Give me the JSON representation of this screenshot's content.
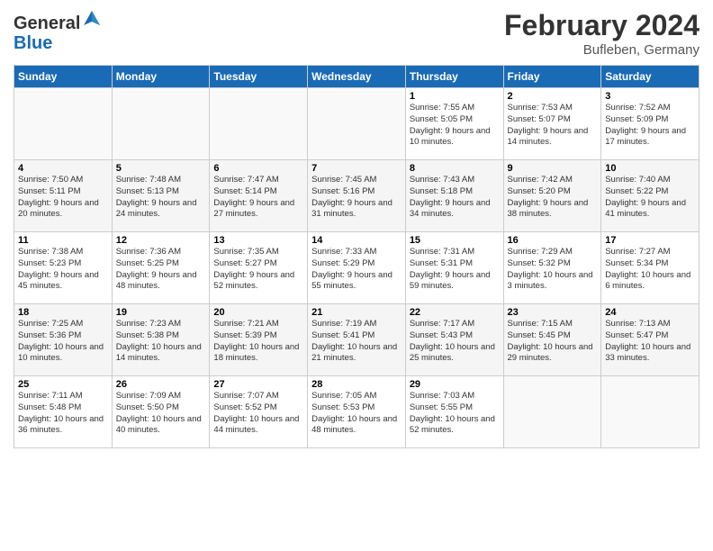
{
  "header": {
    "logo": {
      "general": "General",
      "blue": "Blue"
    },
    "title": "February 2024",
    "subtitle": "Bufleben, Germany"
  },
  "calendar": {
    "days_of_week": [
      "Sunday",
      "Monday",
      "Tuesday",
      "Wednesday",
      "Thursday",
      "Friday",
      "Saturday"
    ],
    "weeks": [
      {
        "alt": false,
        "days": [
          {
            "num": "",
            "info": ""
          },
          {
            "num": "",
            "info": ""
          },
          {
            "num": "",
            "info": ""
          },
          {
            "num": "",
            "info": ""
          },
          {
            "num": "1",
            "info": "Sunrise: 7:55 AM\nSunset: 5:05 PM\nDaylight: 9 hours\nand 10 minutes."
          },
          {
            "num": "2",
            "info": "Sunrise: 7:53 AM\nSunset: 5:07 PM\nDaylight: 9 hours\nand 14 minutes."
          },
          {
            "num": "3",
            "info": "Sunrise: 7:52 AM\nSunset: 5:09 PM\nDaylight: 9 hours\nand 17 minutes."
          }
        ]
      },
      {
        "alt": true,
        "days": [
          {
            "num": "4",
            "info": "Sunrise: 7:50 AM\nSunset: 5:11 PM\nDaylight: 9 hours\nand 20 minutes."
          },
          {
            "num": "5",
            "info": "Sunrise: 7:48 AM\nSunset: 5:13 PM\nDaylight: 9 hours\nand 24 minutes."
          },
          {
            "num": "6",
            "info": "Sunrise: 7:47 AM\nSunset: 5:14 PM\nDaylight: 9 hours\nand 27 minutes."
          },
          {
            "num": "7",
            "info": "Sunrise: 7:45 AM\nSunset: 5:16 PM\nDaylight: 9 hours\nand 31 minutes."
          },
          {
            "num": "8",
            "info": "Sunrise: 7:43 AM\nSunset: 5:18 PM\nDaylight: 9 hours\nand 34 minutes."
          },
          {
            "num": "9",
            "info": "Sunrise: 7:42 AM\nSunset: 5:20 PM\nDaylight: 9 hours\nand 38 minutes."
          },
          {
            "num": "10",
            "info": "Sunrise: 7:40 AM\nSunset: 5:22 PM\nDaylight: 9 hours\nand 41 minutes."
          }
        ]
      },
      {
        "alt": false,
        "days": [
          {
            "num": "11",
            "info": "Sunrise: 7:38 AM\nSunset: 5:23 PM\nDaylight: 9 hours\nand 45 minutes."
          },
          {
            "num": "12",
            "info": "Sunrise: 7:36 AM\nSunset: 5:25 PM\nDaylight: 9 hours\nand 48 minutes."
          },
          {
            "num": "13",
            "info": "Sunrise: 7:35 AM\nSunset: 5:27 PM\nDaylight: 9 hours\nand 52 minutes."
          },
          {
            "num": "14",
            "info": "Sunrise: 7:33 AM\nSunset: 5:29 PM\nDaylight: 9 hours\nand 55 minutes."
          },
          {
            "num": "15",
            "info": "Sunrise: 7:31 AM\nSunset: 5:31 PM\nDaylight: 9 hours\nand 59 minutes."
          },
          {
            "num": "16",
            "info": "Sunrise: 7:29 AM\nSunset: 5:32 PM\nDaylight: 10 hours\nand 3 minutes."
          },
          {
            "num": "17",
            "info": "Sunrise: 7:27 AM\nSunset: 5:34 PM\nDaylight: 10 hours\nand 6 minutes."
          }
        ]
      },
      {
        "alt": true,
        "days": [
          {
            "num": "18",
            "info": "Sunrise: 7:25 AM\nSunset: 5:36 PM\nDaylight: 10 hours\nand 10 minutes."
          },
          {
            "num": "19",
            "info": "Sunrise: 7:23 AM\nSunset: 5:38 PM\nDaylight: 10 hours\nand 14 minutes."
          },
          {
            "num": "20",
            "info": "Sunrise: 7:21 AM\nSunset: 5:39 PM\nDaylight: 10 hours\nand 18 minutes."
          },
          {
            "num": "21",
            "info": "Sunrise: 7:19 AM\nSunset: 5:41 PM\nDaylight: 10 hours\nand 21 minutes."
          },
          {
            "num": "22",
            "info": "Sunrise: 7:17 AM\nSunset: 5:43 PM\nDaylight: 10 hours\nand 25 minutes."
          },
          {
            "num": "23",
            "info": "Sunrise: 7:15 AM\nSunset: 5:45 PM\nDaylight: 10 hours\nand 29 minutes."
          },
          {
            "num": "24",
            "info": "Sunrise: 7:13 AM\nSunset: 5:47 PM\nDaylight: 10 hours\nand 33 minutes."
          }
        ]
      },
      {
        "alt": false,
        "days": [
          {
            "num": "25",
            "info": "Sunrise: 7:11 AM\nSunset: 5:48 PM\nDaylight: 10 hours\nand 36 minutes."
          },
          {
            "num": "26",
            "info": "Sunrise: 7:09 AM\nSunset: 5:50 PM\nDaylight: 10 hours\nand 40 minutes."
          },
          {
            "num": "27",
            "info": "Sunrise: 7:07 AM\nSunset: 5:52 PM\nDaylight: 10 hours\nand 44 minutes."
          },
          {
            "num": "28",
            "info": "Sunrise: 7:05 AM\nSunset: 5:53 PM\nDaylight: 10 hours\nand 48 minutes."
          },
          {
            "num": "29",
            "info": "Sunrise: 7:03 AM\nSunset: 5:55 PM\nDaylight: 10 hours\nand 52 minutes."
          },
          {
            "num": "",
            "info": ""
          },
          {
            "num": "",
            "info": ""
          }
        ]
      }
    ]
  }
}
